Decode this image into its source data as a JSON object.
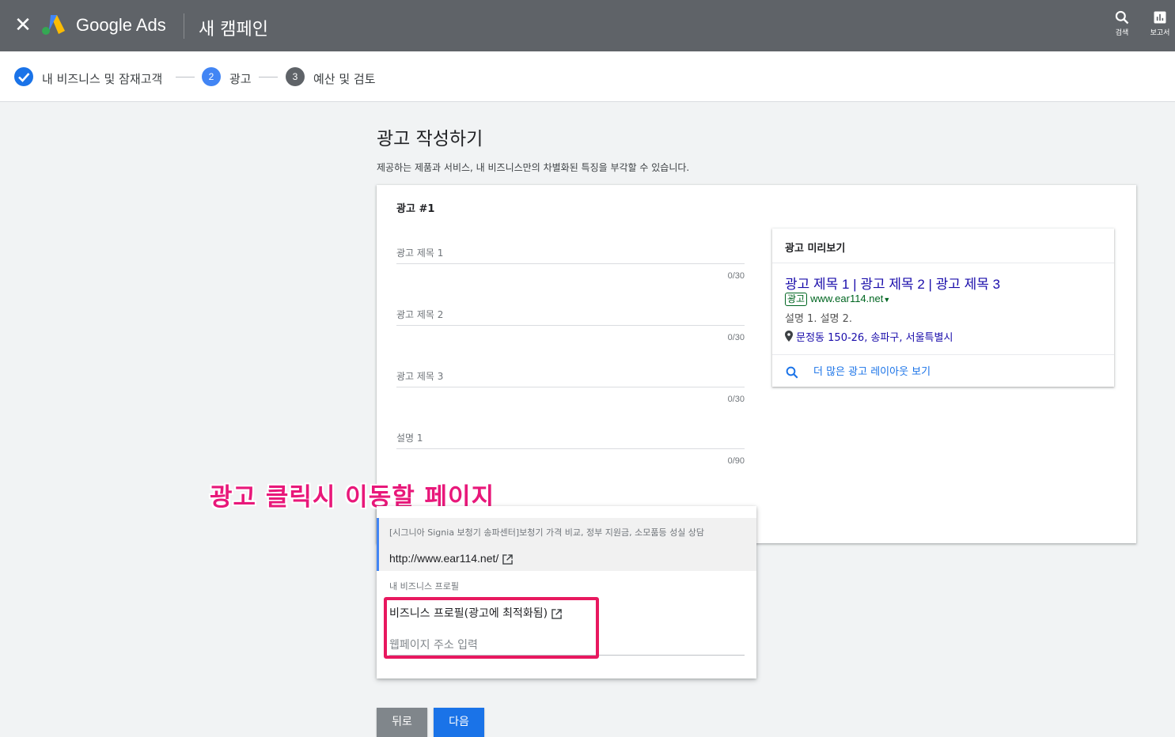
{
  "topbar": {
    "close_icon": "close-icon",
    "brand": "Google Ads",
    "title": "새 캠페인",
    "tools": [
      {
        "icon": "search-icon",
        "label": "검색"
      },
      {
        "icon": "bar-chart-icon",
        "label": "보고서"
      }
    ]
  },
  "stepper": {
    "steps": [
      {
        "label": "내 비즈니스 및 잠재고객",
        "state": "complete"
      },
      {
        "number": "2",
        "label": "광고",
        "state": "active"
      },
      {
        "number": "3",
        "label": "예산 및 검토",
        "state": "pending"
      }
    ]
  },
  "page": {
    "heading": "광고 작성하기",
    "subheading": "제공하는 제품과 서비스, 내 비즈니스만의 차별화된 특징을 부각할 수 있습니다."
  },
  "ad_card": {
    "title": "광고 #1",
    "fields": [
      {
        "label": "광고 제목 1",
        "count": "0/30"
      },
      {
        "label": "광고 제목 2",
        "count": "0/30"
      },
      {
        "label": "광고 제목 3",
        "count": "0/30"
      },
      {
        "label": "설명 1",
        "count": "0/90"
      }
    ]
  },
  "preview": {
    "header": "광고 미리보기",
    "headline": "광고 제목 1 | 광고 제목 2 | 광고 제목 3",
    "badge": "광고",
    "display_url": "www.ear114.net",
    "description": "설명 1. 설명 2.",
    "location": "문정동 150-26, 송파구, 서울특별시",
    "more_layouts": "더 많은 광고 레이아웃 보기"
  },
  "annotation": "광고 클릭시 이동할 페이지",
  "dropdown": {
    "selected_title": "[시그니아 Signia 보청기 송파센터]보청기 가격 비교, 정부 지원금, 소모품등 성실 상담",
    "selected_url": "http://www.ear114.net/",
    "group_label": "내 비즈니스 프로필",
    "option_label": "비즈니스 프로필(광고에 최적화됨)",
    "input_placeholder": "웹페이지 주소 입력"
  },
  "buttons": {
    "back": "뒤로",
    "next": "다음"
  },
  "colors": {
    "topbar": "#5f6368",
    "accent": "#1a73e8",
    "annotation": "#e8187a",
    "highlight": "#e8185f"
  }
}
